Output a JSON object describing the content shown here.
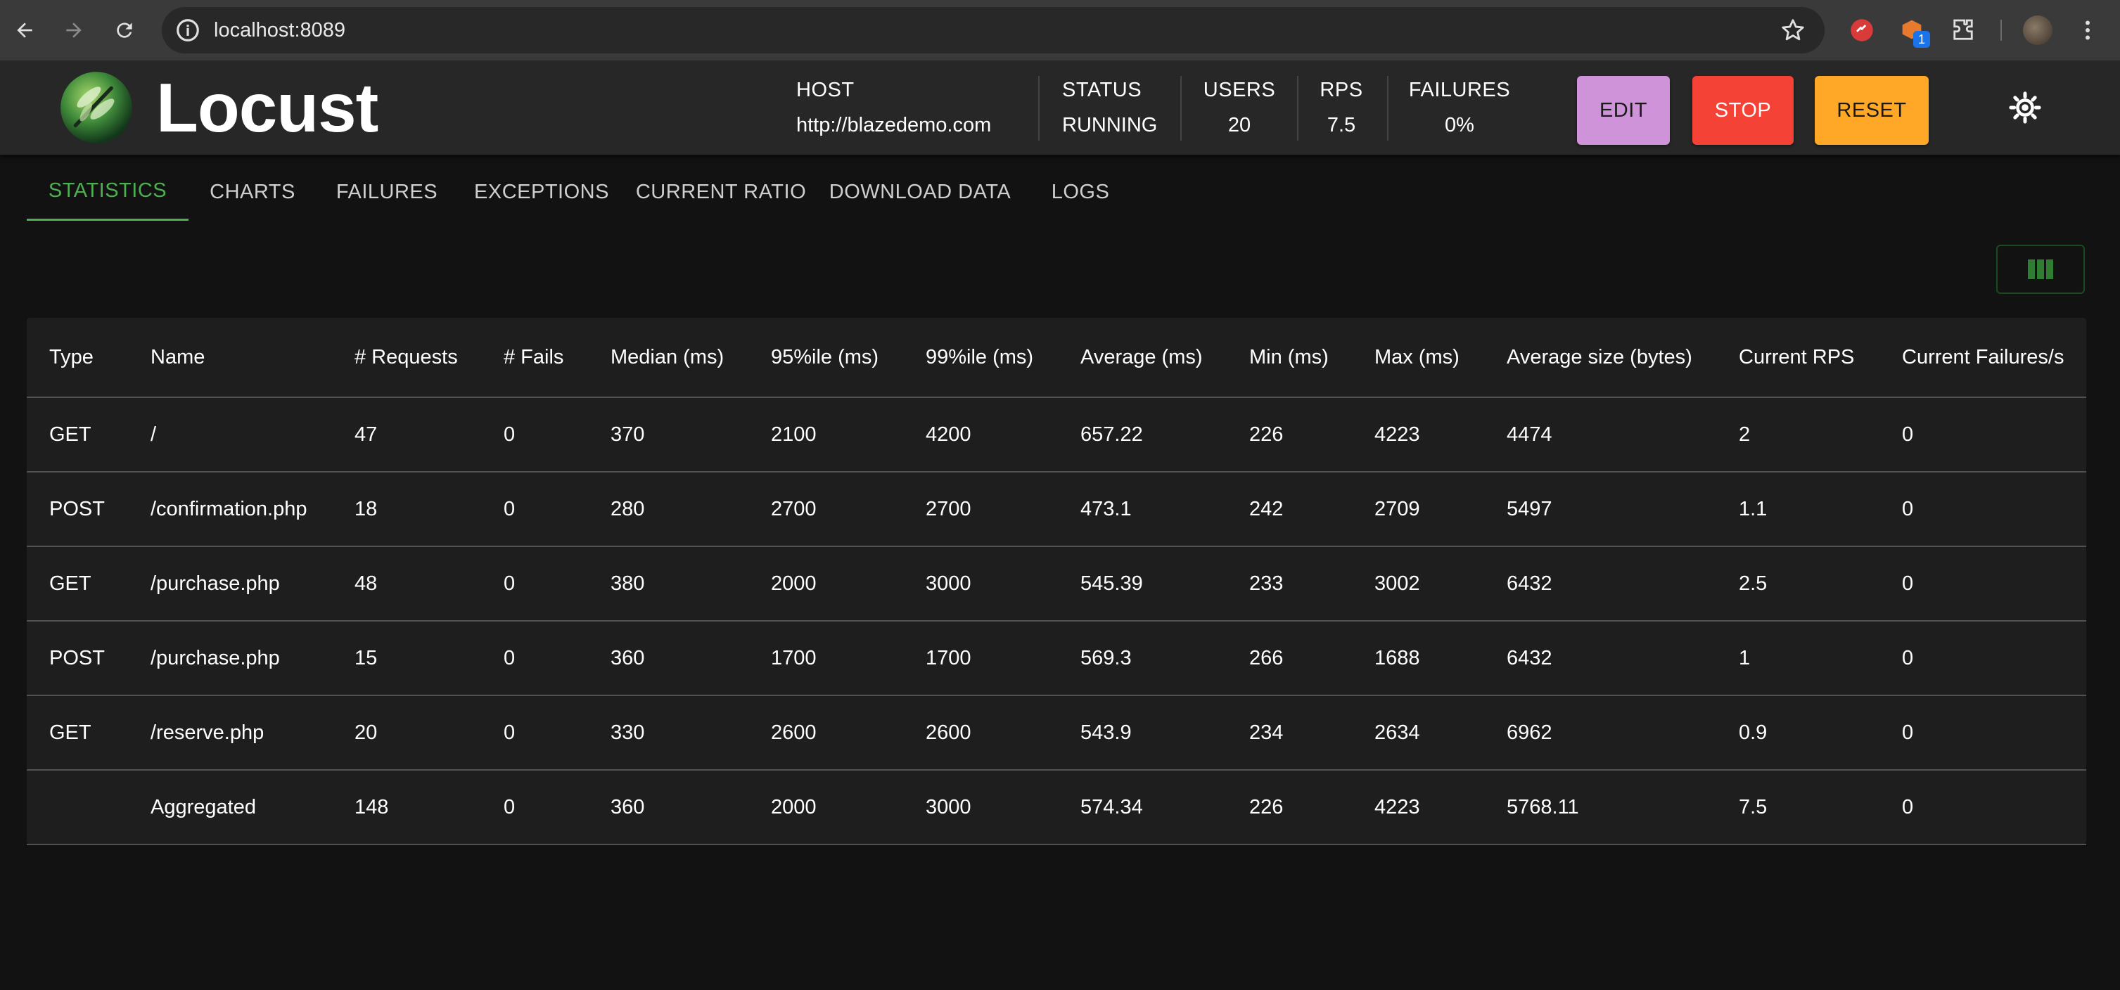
{
  "browser": {
    "url": "localhost:8089",
    "extension_badge": "1"
  },
  "header": {
    "brand": "Locust",
    "host_label": "HOST",
    "host_value": "http://blazedemo.com",
    "status_label": "STATUS",
    "status_value": "RUNNING",
    "users_label": "USERS",
    "users_value": "20",
    "rps_label": "RPS",
    "rps_value": "7.5",
    "failures_label": "FAILURES",
    "failures_value": "0%",
    "edit_label": "EDIT",
    "stop_label": "STOP",
    "reset_label": "RESET"
  },
  "tabs": [
    {
      "label": "STATISTICS",
      "active": true
    },
    {
      "label": "CHARTS"
    },
    {
      "label": "FAILURES"
    },
    {
      "label": "EXCEPTIONS"
    },
    {
      "label": "CURRENT RATIO"
    },
    {
      "label": "DOWNLOAD DATA"
    },
    {
      "label": "LOGS"
    }
  ],
  "table": {
    "headers": [
      "Type",
      "Name",
      "# Requests",
      "# Fails",
      "Median (ms)",
      "95%ile (ms)",
      "99%ile (ms)",
      "Average (ms)",
      "Min (ms)",
      "Max (ms)",
      "Average size (bytes)",
      "Current RPS",
      "Current Failures/s"
    ],
    "rows": [
      [
        "GET",
        "/",
        "47",
        "0",
        "370",
        "2100",
        "4200",
        "657.22",
        "226",
        "4223",
        "4474",
        "2",
        "0"
      ],
      [
        "POST",
        "/confirmation.php",
        "18",
        "0",
        "280",
        "2700",
        "2700",
        "473.1",
        "242",
        "2709",
        "5497",
        "1.1",
        "0"
      ],
      [
        "GET",
        "/purchase.php",
        "48",
        "0",
        "380",
        "2000",
        "3000",
        "545.39",
        "233",
        "3002",
        "6432",
        "2.5",
        "0"
      ],
      [
        "POST",
        "/purchase.php",
        "15",
        "0",
        "360",
        "1700",
        "1700",
        "569.3",
        "266",
        "1688",
        "6432",
        "1",
        "0"
      ],
      [
        "GET",
        "/reserve.php",
        "20",
        "0",
        "330",
        "2600",
        "2600",
        "543.9",
        "234",
        "2634",
        "6962",
        "0.9",
        "0"
      ],
      [
        "",
        "Aggregated",
        "148",
        "0",
        "360",
        "2000",
        "3000",
        "574.34",
        "226",
        "4223",
        "5768.11",
        "7.5",
        "0"
      ]
    ]
  },
  "colors": {
    "accent": "#4caf50",
    "edit": "#ce93d8",
    "stop": "#f44336",
    "reset": "#ffa726"
  }
}
